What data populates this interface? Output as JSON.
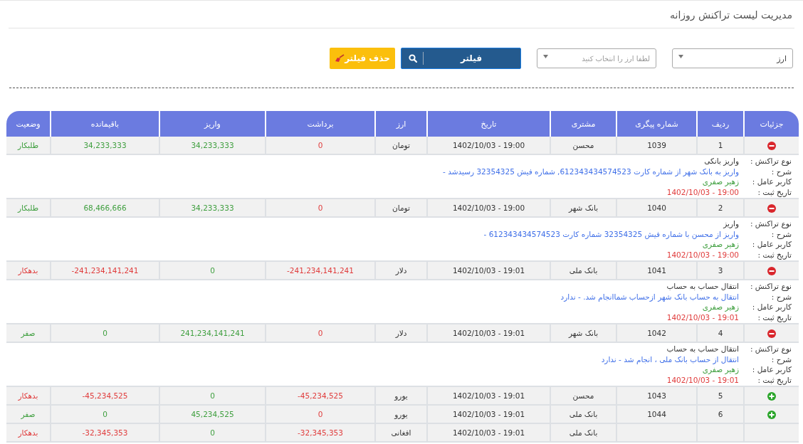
{
  "page_title": "مدیریت لیست تراکنش روزانه",
  "filters": {
    "currency_select": {
      "value": "ارز"
    },
    "currency_picker": {
      "placeholder": "لطفا ارز را انتخاب کنید"
    },
    "filter_button": "فیلتر",
    "clear_button": "حذف فیلتر"
  },
  "table": {
    "columns": [
      "جزئیات",
      "ردیف",
      "شماره پیگری",
      "مشتری",
      "تاریخ",
      "ارز",
      "برداشت",
      "واریز",
      "باقیمانده",
      "وضعیت"
    ],
    "rows": [
      {
        "expanded": true,
        "index": "1",
        "tracking": "1039",
        "customer": "محسن",
        "date": "1402/10/03 - 19:00",
        "currency": "تومان",
        "withdraw": "0",
        "deposit": "34,233,333",
        "balance": "34,233,333",
        "status": "طلبکار",
        "kind": "credit",
        "details": [
          {
            "label": "نوع تراکنش :",
            "value": "واریز بانکی",
            "kind": "plain"
          },
          {
            "label": "شرح :",
            "value": "واریز به بانک شهر از شماره کارت 612343434574523, شماره فیش 32354325 رسیدشد -",
            "kind": "desc"
          },
          {
            "label": "کاربر عامل :",
            "value": "زهیر صفری",
            "kind": "user"
          },
          {
            "label": "تاریخ ثبت :",
            "value": "1402/10/03 - 19:00",
            "kind": "date"
          }
        ]
      },
      {
        "expanded": true,
        "index": "2",
        "tracking": "1040",
        "customer": "بانک شهر",
        "date": "1402/10/03 - 19:00",
        "currency": "تومان",
        "withdraw": "0",
        "deposit": "34,233,333",
        "balance": "68,466,666",
        "status": "طلبکار",
        "kind": "credit",
        "details": [
          {
            "label": "نوع تراکنش :",
            "value": "واریز",
            "kind": "plain"
          },
          {
            "label": "شرح :",
            "value": "واریز از محسن با شماره فیش 32354325 شماره کارت 612343434574523 -",
            "kind": "desc"
          },
          {
            "label": "کاربر عامل :",
            "value": "زهیر صفری",
            "kind": "user"
          },
          {
            "label": "تاریخ ثبت :",
            "value": "1402/10/03 - 19:00",
            "kind": "date"
          }
        ]
      },
      {
        "expanded": true,
        "index": "3",
        "tracking": "1041",
        "customer": "بانک ملی",
        "date": "1402/10/03 - 19:01",
        "currency": "دلار",
        "withdraw": "-241,234,141,241",
        "deposit": "0",
        "balance": "-241,234,141,241",
        "status": "بدهکار",
        "kind": "debit",
        "details": [
          {
            "label": "نوع تراکنش :",
            "value": "انتقال حساب به حساب",
            "kind": "plain"
          },
          {
            "label": "شرح :",
            "value": "انتقال به حساب بانک شهر ازحساب شماانجام شد. - ندارد",
            "kind": "desc"
          },
          {
            "label": "کاربر عامل :",
            "value": "زهیر صفری",
            "kind": "user"
          },
          {
            "label": "تاریخ ثبت :",
            "value": "1402/10/03 - 19:01",
            "kind": "date"
          }
        ]
      },
      {
        "expanded": true,
        "index": "4",
        "tracking": "1042",
        "customer": "بانک شهر",
        "date": "1402/10/03 - 19:01",
        "currency": "دلار",
        "withdraw": "0",
        "deposit": "241,234,141,241",
        "balance": "0",
        "status": "صفر",
        "kind": "zero",
        "details": [
          {
            "label": "نوع تراکنش :",
            "value": "انتقال حساب به حساب",
            "kind": "plain"
          },
          {
            "label": "شرح :",
            "value": "انتقال از حساب بانک ملی ، انجام شد - ندارد",
            "kind": "desc"
          },
          {
            "label": "کاربر عامل :",
            "value": "زهیر صفری",
            "kind": "user"
          },
          {
            "label": "تاریخ ثبت :",
            "value": "1402/10/03 - 19:01",
            "kind": "date"
          }
        ]
      },
      {
        "expanded": false,
        "index": "5",
        "tracking": "1043",
        "customer": "محسن",
        "date": "1402/10/03 - 19:01",
        "currency": "یورو",
        "withdraw": "-45,234,525",
        "deposit": "0",
        "balance": "-45,234,525",
        "status": "بدهکار",
        "kind": "debit"
      },
      {
        "expanded": false,
        "index": "6",
        "tracking": "1044",
        "customer": "بانک ملی",
        "date": "1402/10/03 - 19:01",
        "currency": "یورو",
        "withdraw": "0",
        "deposit": "45,234,525",
        "balance": "0",
        "status": "صفر",
        "kind": "zero"
      },
      {
        "customer": "بانک ملی",
        "date": "1402/10/03 - 19:01",
        "currency": "افغانی",
        "withdraw": "-32,345,353",
        "deposit": "0",
        "balance": "-32,345,353",
        "status": "بدهکار",
        "kind": "debit"
      }
    ]
  }
}
